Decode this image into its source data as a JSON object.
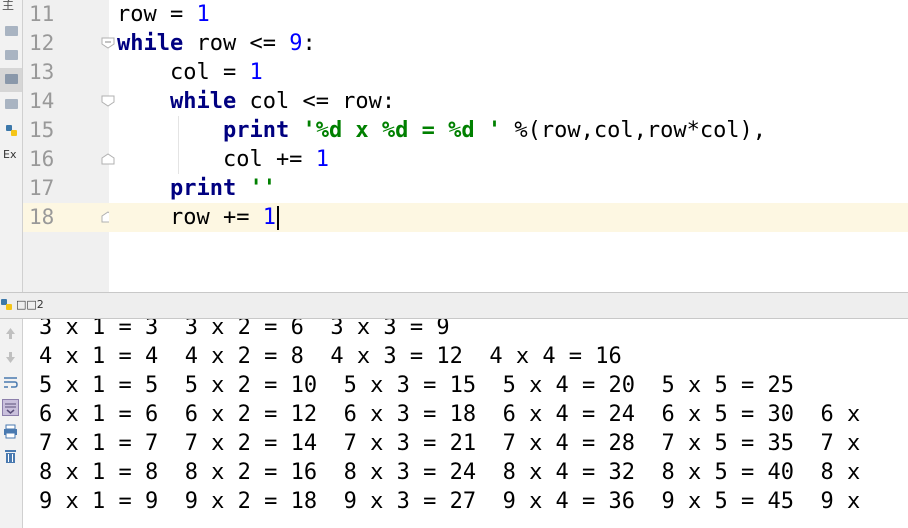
{
  "project_panel": {
    "cut_label": "主",
    "ext_label": "Ex"
  },
  "editor": {
    "lines": [
      {
        "number": "11",
        "text": "row = 1"
      },
      {
        "number": "12",
        "text": "while row <= 9:"
      },
      {
        "number": "13",
        "text": "    col = 1"
      },
      {
        "number": "14",
        "text": "    while col <= row:"
      },
      {
        "number": "15",
        "text": "        print '%d x %d = %d ' %(row,col,row*col),"
      },
      {
        "number": "16",
        "text": "        col += 1"
      },
      {
        "number": "17",
        "text": "    print ''"
      },
      {
        "number": "18",
        "text": "    row += 1"
      }
    ],
    "current_line": "18"
  },
  "run_panel": {
    "title": "□□2",
    "output": [
      "3 x 1 = 3  3 x 2 = 6  3 x 3 = 9",
      "4 x 1 = 4  4 x 2 = 8  4 x 3 = 12  4 x 4 = 16",
      "5 x 1 = 5  5 x 2 = 10  5 x 3 = 15  5 x 4 = 20  5 x 5 = 25",
      "6 x 1 = 6  6 x 2 = 12  6 x 3 = 18  6 x 4 = 24  6 x 5 = 30  6 x",
      "7 x 1 = 7  7 x 2 = 14  7 x 3 = 21  7 x 4 = 28  7 x 5 = 35  7 x",
      "8 x 1 = 8  8 x 2 = 16  8 x 3 = 24  8 x 4 = 32  8 x 5 = 40  8 x",
      "9 x 1 = 9  9 x 2 = 18  9 x 3 = 27  9 x 4 = 36  9 x 5 = 45  9 x"
    ]
  },
  "icons": {
    "toolbar": [
      "up-arrow-icon",
      "down-arrow-icon",
      "soft-wrap-icon",
      "scroll-to-end-icon",
      "print-icon",
      "trash-icon"
    ]
  },
  "colors": {
    "keyword": "#000080",
    "number": "#0000ff",
    "string": "#008000",
    "current_line": "#fdf7e2"
  }
}
